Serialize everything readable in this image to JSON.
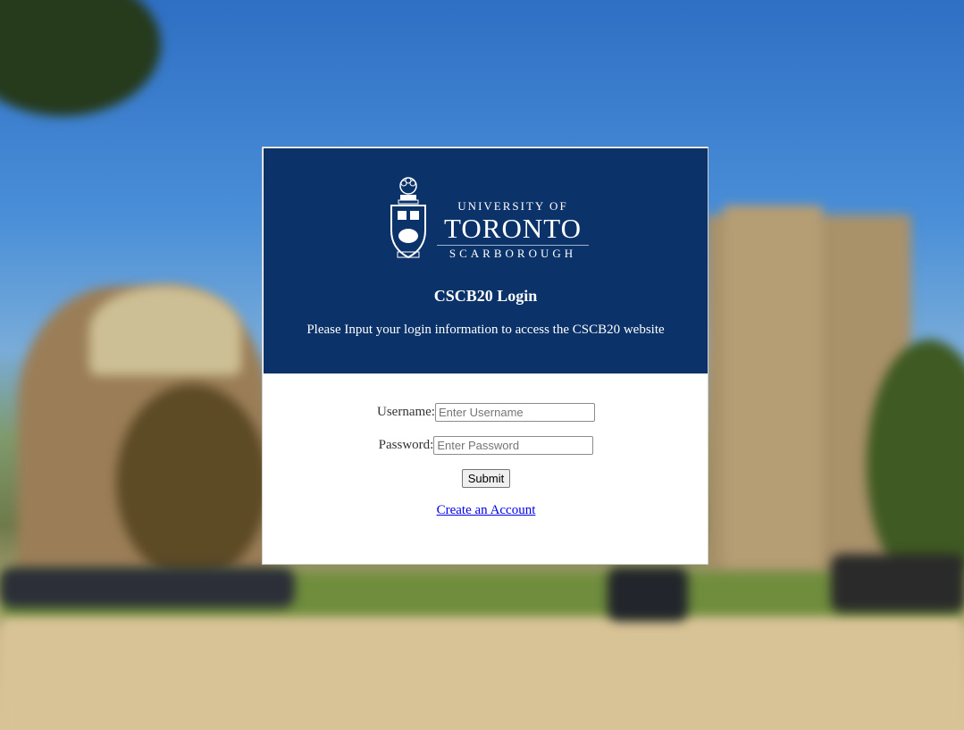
{
  "logo": {
    "line1": "UNIVERSITY OF",
    "line2": "TORONTO",
    "line3": "SCARBOROUGH"
  },
  "header": {
    "title": "CSCB20 Login",
    "subtitle": "Please Input your login information to access the CSCB20 website"
  },
  "form": {
    "username_label": "Username:",
    "username_placeholder": "Enter Username",
    "password_label": "Password:",
    "password_placeholder": "Enter Password",
    "submit_label": "Submit",
    "create_account_label": "Create an Account"
  },
  "colors": {
    "header_bg": "#0b3269",
    "link": "#0000ee"
  }
}
